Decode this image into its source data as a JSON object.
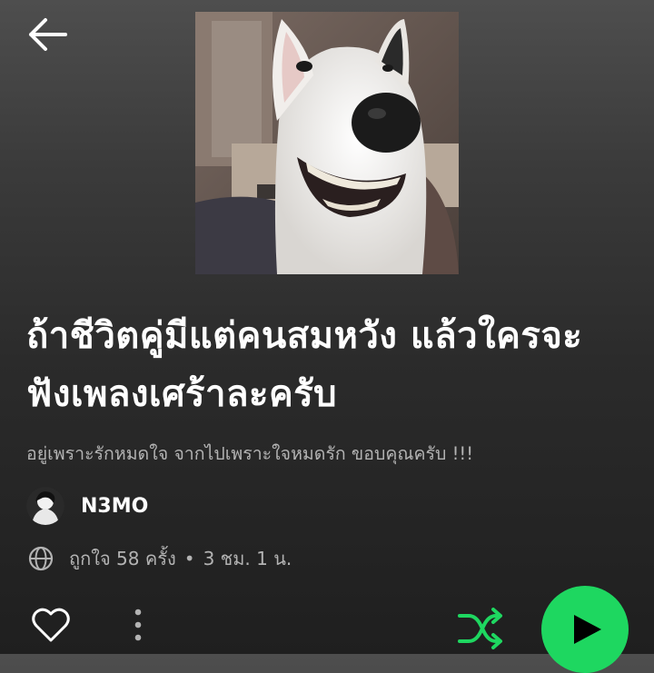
{
  "colors": {
    "accent": "#1ed760",
    "secondary_text": "#b3b3b3",
    "primary_text": "#ffffff"
  },
  "header": {
    "back_icon": "arrow-left-icon"
  },
  "playlist": {
    "cover_description": "photo of a smiling white bull terrier",
    "title": "ถ้าชีวิตคู่มีแต่คนสมหวัง แล้วใครจะฟังเพลงเศร้าละครับ",
    "description": "อยู่เพราะรักหมดใจ จากไปเพราะใจหมดรัก ขอบคุณครับ !!!",
    "owner": {
      "name": "N3MO"
    },
    "meta": {
      "visibility_icon": "globe-icon",
      "likes": "ถูกใจ 58 ครั้ง",
      "separator": "•",
      "duration": "3 ชม. 1 น."
    }
  },
  "actions": {
    "like_icon": "heart-outline-icon",
    "more_icon": "more-vertical-icon",
    "shuffle_icon": "shuffle-icon",
    "play_icon": "play-icon"
  }
}
